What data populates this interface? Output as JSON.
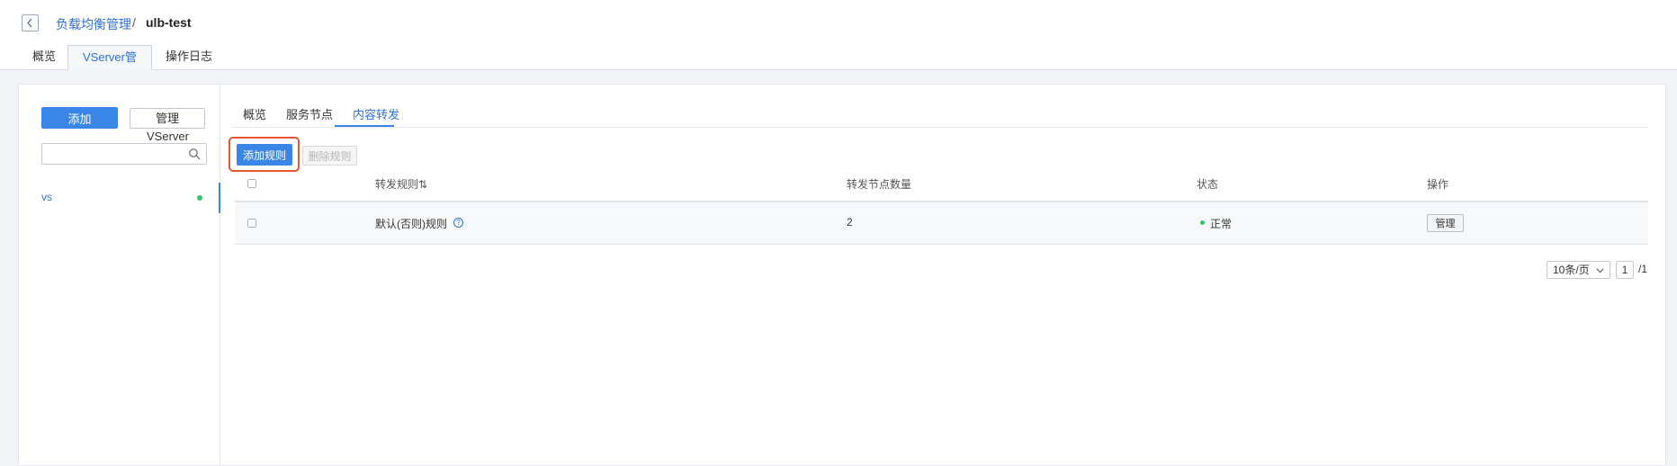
{
  "breadcrumb": {
    "parent": "负载均衡管理",
    "separator": "/",
    "current": "ulb-test"
  },
  "tabs": {
    "overview": "概览",
    "vserver": "VServer管理",
    "log": "操作日志"
  },
  "sidebar": {
    "add_label": "添加",
    "manage_label": "管理",
    "manage_overflow": "VServer",
    "search_value": "",
    "items": [
      {
        "label": "vs",
        "status": "green"
      }
    ]
  },
  "subtabs": {
    "overview": "概览",
    "nodes": "服务节点",
    "content": "内容转发"
  },
  "toolbar": {
    "add_rule": "添加规则",
    "delete_rule": "删除规则"
  },
  "table": {
    "headers": {
      "rule": "转发规则⇅",
      "node_count": "转发节点数量",
      "status": "状态",
      "action": "操作"
    },
    "rows": [
      {
        "rule": "默认(否则)规则",
        "node_count": "2",
        "status": "正常",
        "action": "管理"
      }
    ]
  },
  "pagination": {
    "page_size": "10条/页",
    "page": "1",
    "total": "/1"
  },
  "colors": {
    "accent": "#3a86e6",
    "link": "#2f6fd6",
    "ok": "#39c26a",
    "highlight": "#e5552e"
  }
}
